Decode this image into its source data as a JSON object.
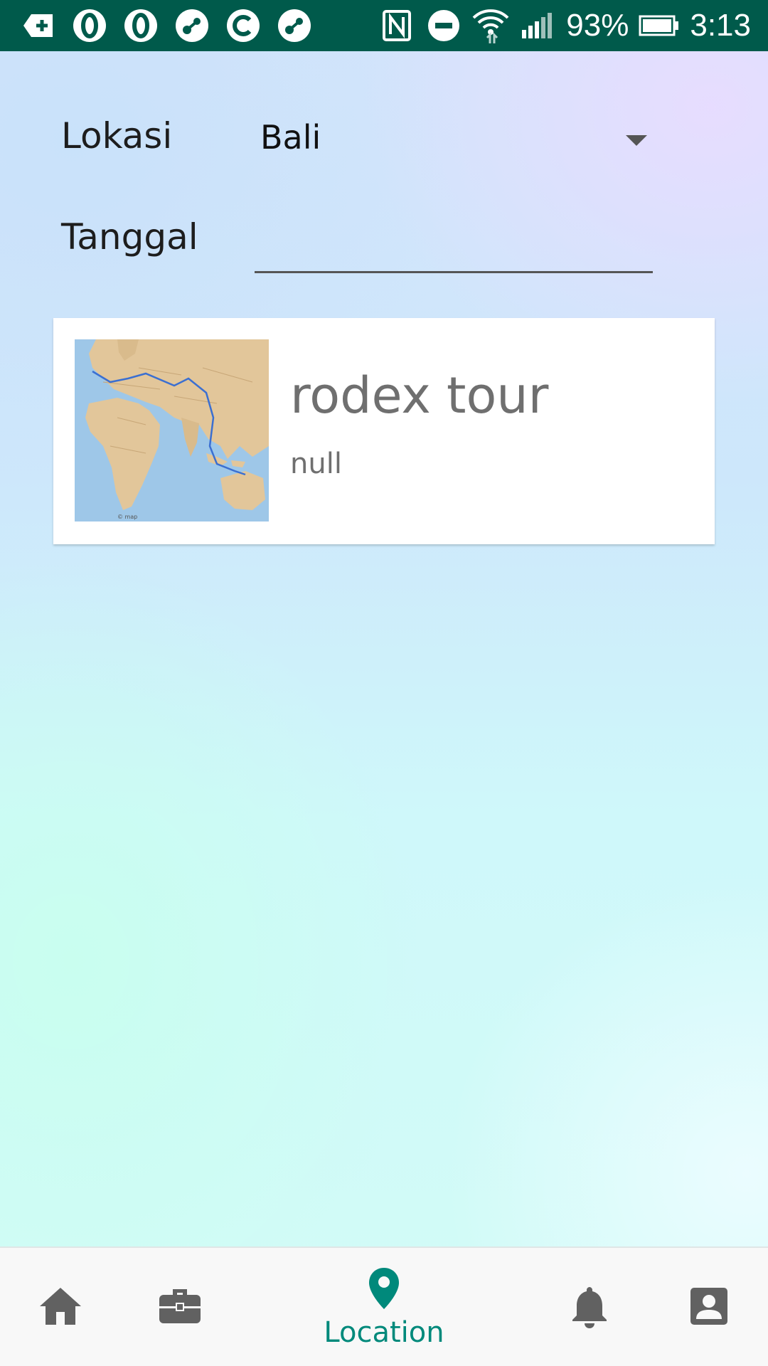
{
  "status_bar": {
    "battery": "93%",
    "time": "3:13"
  },
  "form": {
    "location_label": "Lokasi",
    "location_value": "Bali",
    "date_label": "Tanggal",
    "date_value": "",
    "date_placeholder": ""
  },
  "tours": [
    {
      "title": "rodex tour",
      "subtitle": "null",
      "image": "world-route-map"
    }
  ],
  "bottom_nav": {
    "items": [
      {
        "icon": "home-icon",
        "label": ""
      },
      {
        "icon": "briefcase-icon",
        "label": ""
      },
      {
        "icon": "location-pin-icon",
        "label": "Location",
        "active": true
      },
      {
        "icon": "bell-icon",
        "label": ""
      },
      {
        "icon": "account-box-icon",
        "label": ""
      }
    ]
  },
  "colors": {
    "status_bar": "#005a4b",
    "accent": "#00897b",
    "icon_inactive": "#616161",
    "card_text": "#6f6f6f"
  }
}
